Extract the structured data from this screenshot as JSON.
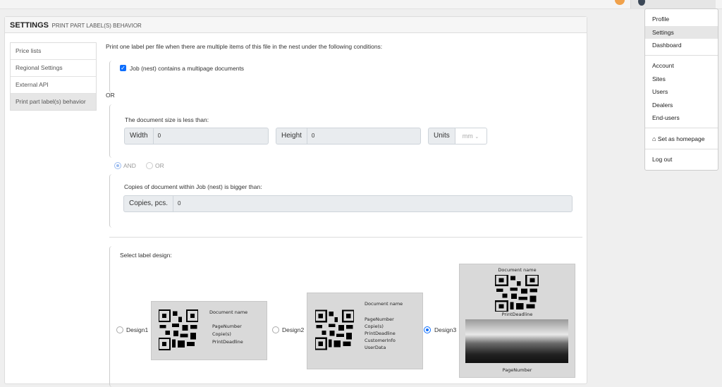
{
  "header": {
    "title": "SETTINGS",
    "subtitle": "PRINT PART LABEL(S) BEHAVIOR"
  },
  "sidebar": {
    "items": [
      {
        "label": "Price lists"
      },
      {
        "label": "Regional Settings"
      },
      {
        "label": "External API"
      },
      {
        "label": "Print part label(s) behavior",
        "active": true
      }
    ]
  },
  "main": {
    "intro": "Print one label per file when there are multiple items of this file in the nest under the following conditions:",
    "multipage_label": "Job (nest) contains a multipage documents",
    "multipage_checked": true,
    "or_label": "OR",
    "doc_size_label": "The document size is less than:",
    "width_label": "Width",
    "width_value": "0",
    "height_label": "Height",
    "height_value": "0",
    "units_label": "Units",
    "units_value": "mm",
    "and_label": "AND",
    "or2_label": "OR",
    "copies_label": "Copies of document within Job (nest) is bigger than:",
    "copies_field_label": "Copies, pcs.",
    "copies_value": "0",
    "select_design_label": "Select label design:",
    "designs": [
      {
        "label": "Design1",
        "selected": false,
        "lines": [
          "Document name",
          "PageNumber",
          "Copie(s)",
          "PrintDeadline"
        ]
      },
      {
        "label": "Design2",
        "selected": false,
        "lines": [
          "Document name",
          "PageNumber",
          "Copie(s)",
          "PrintDeadline",
          "CustomerInfo",
          "UserData"
        ]
      },
      {
        "label": "Design3",
        "selected": true,
        "lines": [
          "Document name",
          "PrintDeadline",
          "PageNumber"
        ]
      }
    ]
  },
  "user_menu": {
    "items": [
      {
        "label": "Profile"
      },
      {
        "label": "Settings",
        "active": true
      },
      {
        "label": "Dashboard"
      },
      {
        "label": "Account"
      },
      {
        "label": "Sites"
      },
      {
        "label": "Users"
      },
      {
        "label": "Dealers"
      },
      {
        "label": "End-users"
      },
      {
        "label": "Set as homepage",
        "icon": "home-icon"
      },
      {
        "label": "Log out"
      }
    ]
  },
  "colors": {
    "accent": "#0d6efd",
    "notification": "#f0a14b"
  }
}
